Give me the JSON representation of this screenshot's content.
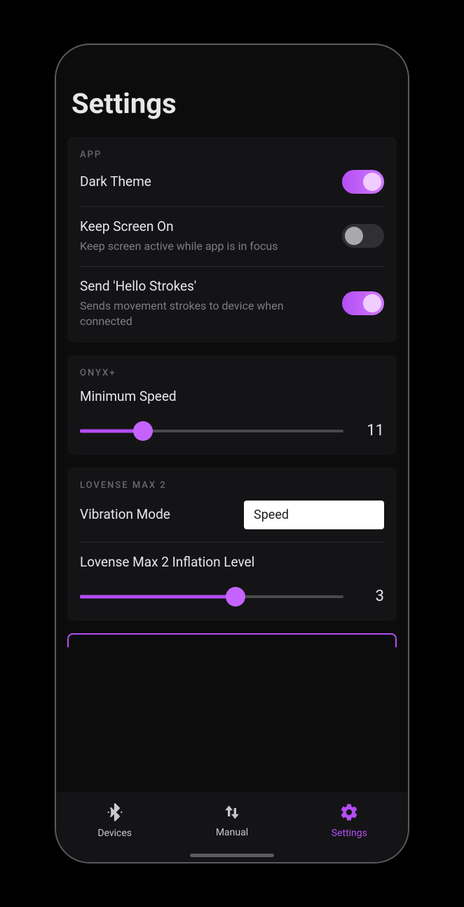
{
  "page_title": "Settings",
  "colors": {
    "accent": "#b54df4",
    "accent_light": "#cf7bff"
  },
  "sections": {
    "app": {
      "header": "APP",
      "dark_theme": {
        "label": "Dark Theme",
        "on": true
      },
      "keep_screen": {
        "label": "Keep Screen On",
        "sub": "Keep screen active while app is in focus",
        "on": false
      },
      "hello_strokes": {
        "label": "Send 'Hello Strokes'",
        "sub": "Sends movement strokes to device when connected",
        "on": true
      }
    },
    "onyx": {
      "header": "ONYX+",
      "min_speed": {
        "label": "Minimum Speed",
        "value": "11",
        "percent": 24
      }
    },
    "lovense": {
      "header": "LOVENSE MAX 2",
      "vibration_mode": {
        "label": "Vibration Mode",
        "value": "Speed"
      },
      "inflation": {
        "label": "Lovense Max 2 Inflation Level",
        "value": "3",
        "percent": 59
      }
    }
  },
  "nav": {
    "devices": "Devices",
    "manual": "Manual",
    "settings": "Settings"
  }
}
